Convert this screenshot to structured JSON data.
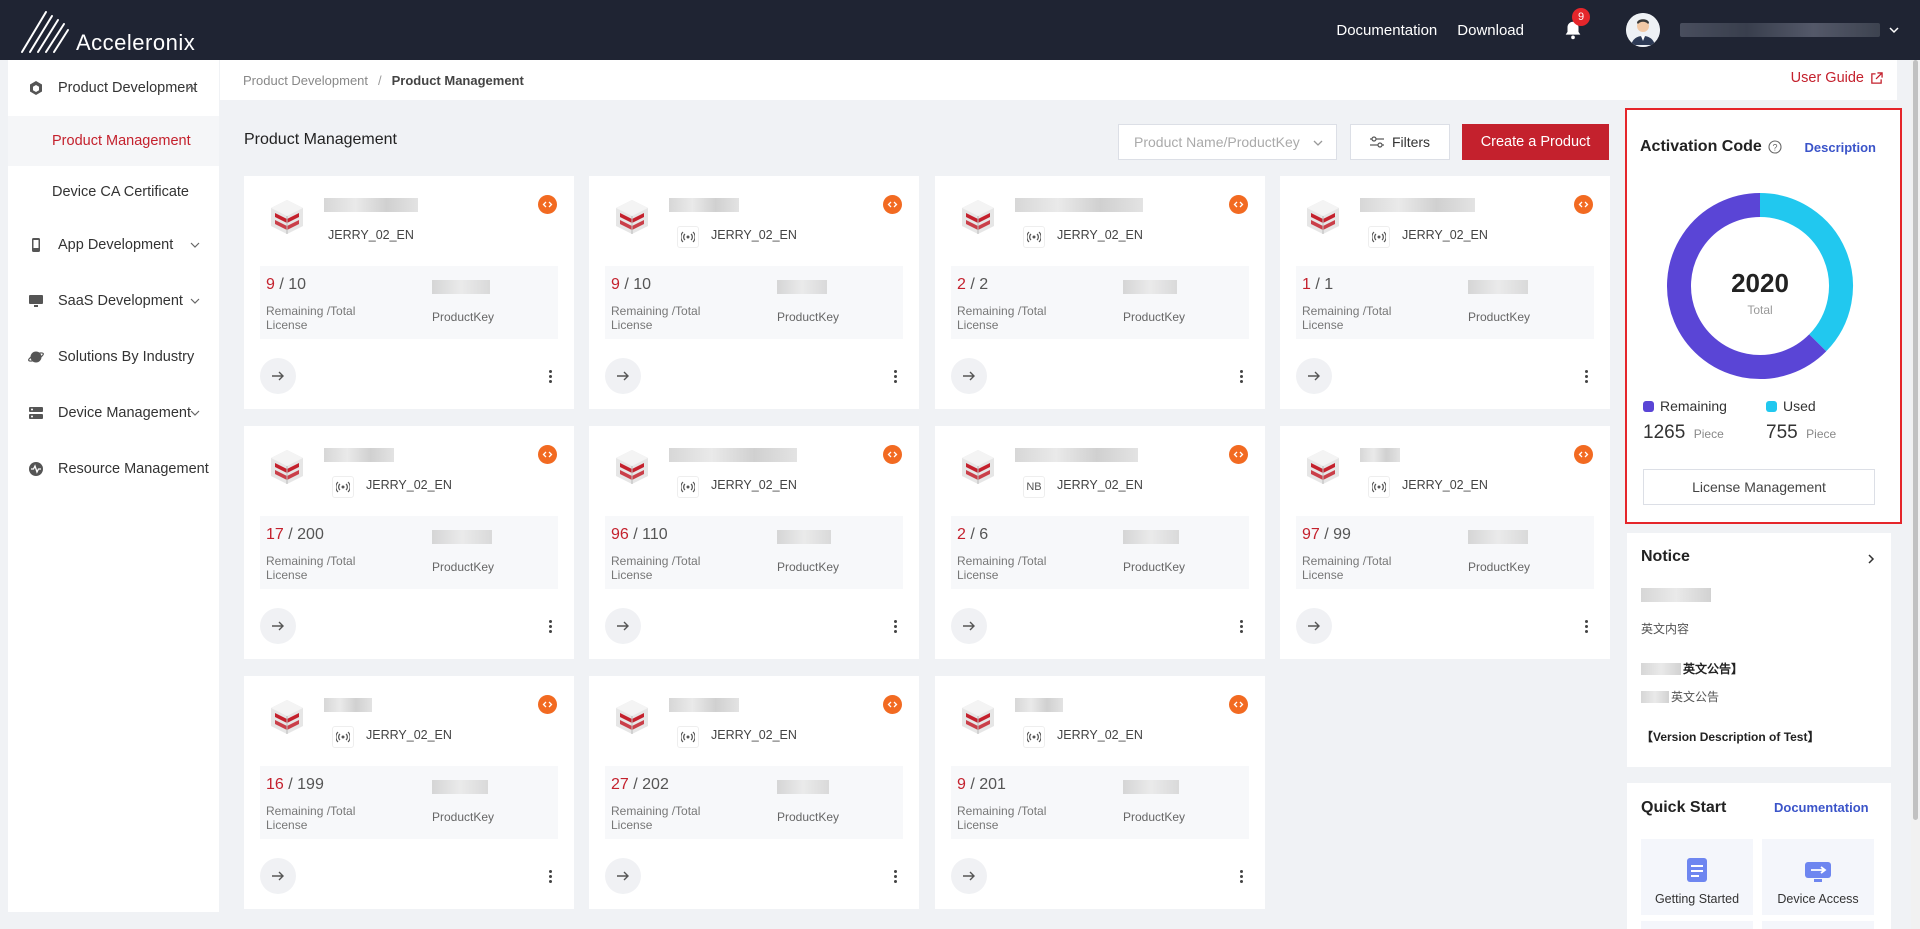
{
  "app": {
    "brand": "Acceleronix"
  },
  "topbar": {
    "documentation": "Documentation",
    "download": "Download",
    "notifications": "9"
  },
  "sidebar": {
    "items": [
      {
        "label": "Product Development",
        "icon": "cube-icon",
        "expanded": true
      },
      {
        "label": "Product Management",
        "sub": true,
        "active": true
      },
      {
        "label": "Device CA Certificate",
        "sub": true
      },
      {
        "label": "App Development",
        "icon": "mobile-icon"
      },
      {
        "label": "SaaS Development",
        "icon": "monitor-icon"
      },
      {
        "label": "Solutions By Industry",
        "icon": "planet-icon"
      },
      {
        "label": "Device Management",
        "icon": "server-icon"
      },
      {
        "label": "Resource Management",
        "icon": "pulse-icon"
      }
    ]
  },
  "breadcrumb": {
    "parent": "Product Development",
    "separator": "/",
    "current": "Product Management",
    "user_guide": "User Guide"
  },
  "main": {
    "title": "Product Management",
    "search_placeholder": "Product Name/ProductKey",
    "filters": "Filters",
    "create": "Create a Product"
  },
  "card_labels": {
    "license": "Remaining /Total License",
    "product_key": "ProductKey"
  },
  "cards": [
    {
      "tag": "JERRY_02_EN",
      "net": "",
      "remaining": "9",
      "total": "10"
    },
    {
      "tag": "JERRY_02_EN",
      "net": "wifi",
      "remaining": "9",
      "total": "10"
    },
    {
      "tag": "JERRY_02_EN",
      "net": "wifi",
      "remaining": "2",
      "total": "2"
    },
    {
      "tag": "JERRY_02_EN",
      "net": "wifi",
      "remaining": "1",
      "total": "1"
    },
    {
      "tag": "JERRY_02_EN",
      "net": "wifi",
      "remaining": "17",
      "total": "200"
    },
    {
      "tag": "JERRY_02_EN",
      "net": "wifi",
      "remaining": "96",
      "total": "110"
    },
    {
      "tag": "JERRY_02_EN",
      "net": "NB",
      "remaining": "2",
      "total": "6"
    },
    {
      "tag": "JERRY_02_EN",
      "net": "wifi",
      "remaining": "97",
      "total": "99"
    },
    {
      "tag": "JERRY_02_EN",
      "net": "wifi",
      "remaining": "16",
      "total": "199"
    },
    {
      "tag": "JERRY_02_EN",
      "net": "wifi",
      "remaining": "27",
      "total": "202"
    },
    {
      "tag": "JERRY_02_EN",
      "net": "wifi",
      "remaining": "9",
      "total": "201"
    }
  ],
  "activation": {
    "title": "Activation Code",
    "description": "Description",
    "total": "2020",
    "total_label": "Total",
    "remaining_label": "Remaining",
    "used_label": "Used",
    "remaining": 1265,
    "used": 755,
    "unit": "Piece",
    "license_button": "License Management",
    "colors": {
      "remaining": "#5a45d6",
      "used": "#21c8ef"
    }
  },
  "notice": {
    "title": "Notice",
    "items": [
      "英文内容",
      "英文公告】",
      "英文公告",
      "【Version Description of Test】"
    ]
  },
  "quickstart": {
    "title": "Quick Start",
    "documentation": "Documentation",
    "tiles": [
      {
        "label": "Getting Started",
        "icon": "document-icon"
      },
      {
        "label": "Device Access",
        "icon": "device-access-icon"
      }
    ]
  },
  "colors": {
    "brand_red": "#c4212d",
    "topbar": "#1f2433",
    "badge_orange": "#f26a21",
    "link_blue": "#3b54c9"
  }
}
